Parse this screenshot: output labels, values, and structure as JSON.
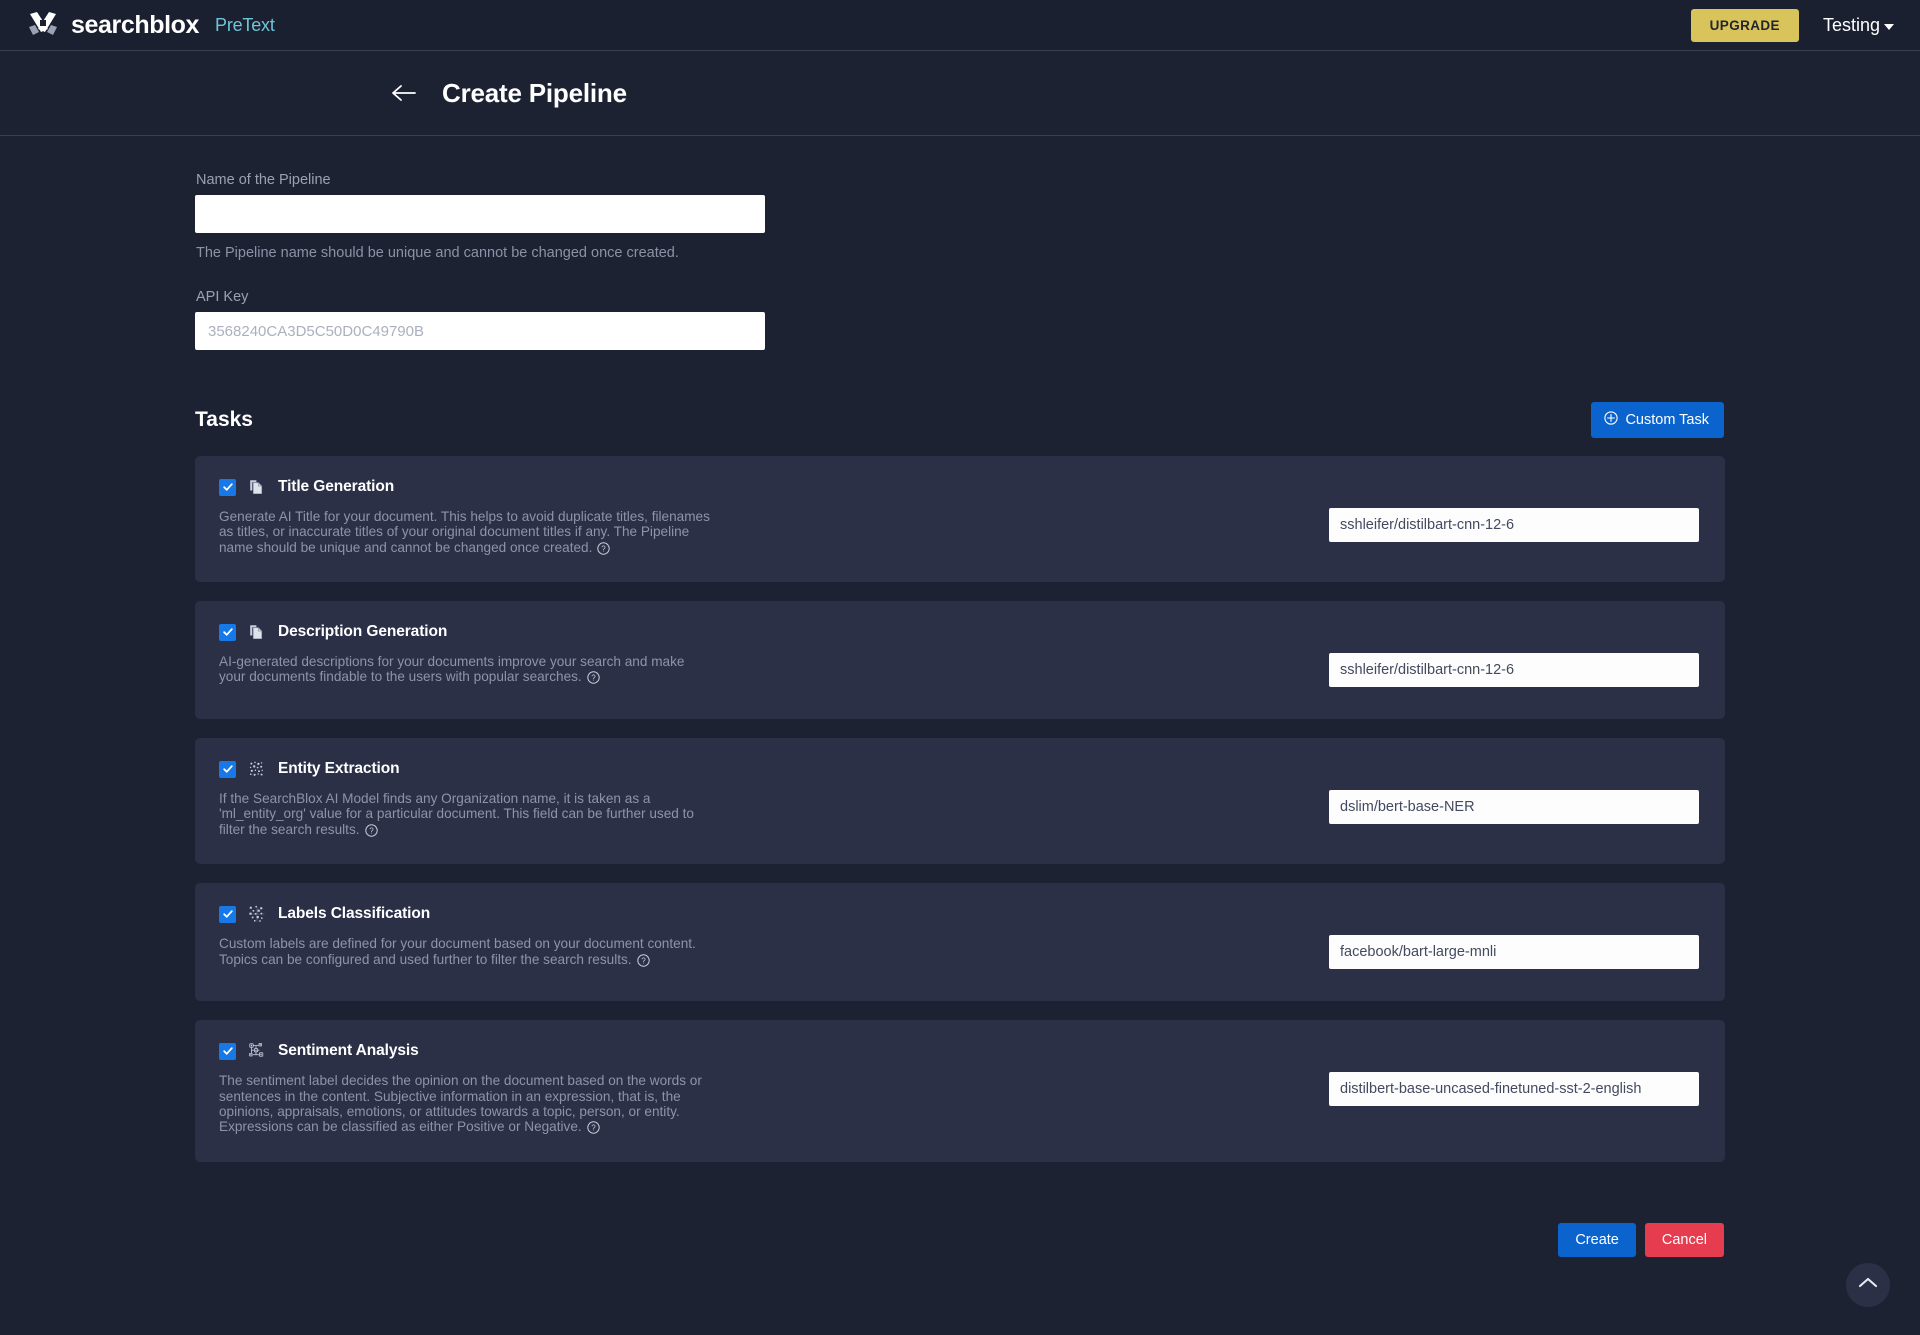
{
  "navbar": {
    "brand_name": "searchblox",
    "brand_sub": "PreText",
    "logo_icon": "searchblox-x-logo-icon",
    "upgrade_label": "UPGRADE",
    "user_label": "Testing",
    "caret_icon": "chevron-down-icon"
  },
  "titlebar": {
    "back_icon": "arrow-left-icon",
    "title": "Create Pipeline"
  },
  "form": {
    "name_label": "Name of the Pipeline",
    "name_value": "",
    "name_placeholder": "",
    "name_help": "The Pipeline name should be unique and cannot be changed once created.",
    "api_label": "API Key",
    "api_placeholder": "3568240CA3D5C50D0C49790B",
    "api_value": ""
  },
  "tasks_header": {
    "title": "Tasks",
    "custom_task_label": "Custom Task",
    "custom_task_icon": "plus-circle-icon"
  },
  "tasks": [
    {
      "id": "title-generation",
      "checked": true,
      "icon": "copy-document-icon",
      "title": "Title Generation",
      "description": "Generate AI Title for your document. This helps to avoid duplicate titles, filenames as titles, or inaccurate titles of your original document titles if any. The Pipeline name should be unique and cannot be changed once created.",
      "help_icon": "question-circle-icon",
      "model_value": "sshleifer/distilbart-cnn-12-6",
      "model_placeholder": "sshleifer/distilbart-cnn-12-6"
    },
    {
      "id": "description-generation",
      "checked": true,
      "icon": "copy-document-icon",
      "title": "Description Generation",
      "description": "AI-generated descriptions for your documents improve your search and make your documents findable to the users with popular searches.",
      "help_icon": "question-circle-icon",
      "model_value": "sshleifer/distilbart-cnn-12-6",
      "model_placeholder": "sshleifer/distilbart-cnn-12-6"
    },
    {
      "id": "entity-extraction",
      "checked": true,
      "icon": "scatter-dots-icon",
      "title": "Entity Extraction",
      "description": "If the SearchBlox AI Model finds any Organization name, it is taken as a 'ml_entity_org' value for a particular document. This field can be further used to filter the search results.",
      "help_icon": "question-circle-icon",
      "model_value": "dslim/bert-base-NER",
      "model_placeholder": "dslim/bert-base-NER"
    },
    {
      "id": "labels-classification",
      "checked": true,
      "icon": "label-cluster-icon",
      "title": "Labels Classification",
      "description": "Custom labels are defined for your document based on your document content. Topics can be configured and used further to filter the search results.",
      "help_icon": "question-circle-icon",
      "model_value": "facebook/bart-large-mnli",
      "model_placeholder": "facebook/bart-large-mnli"
    },
    {
      "id": "sentiment-analysis",
      "checked": true,
      "icon": "node-graph-icon",
      "title": "Sentiment Analysis",
      "description": "The sentiment label decides the opinion on the document based on the words or sentences in the content. Subjective information in an expression, that is, the opinions, appraisals, emotions, or attitudes towards a topic, person, or entity. Expressions can be classified as either Positive or Negative.",
      "help_icon": "question-circle-icon",
      "model_value": "distilbert-base-uncased-finetuned-sst-2-english",
      "model_placeholder": "distilbert-base-uncased-finetuned-sst-2-english"
    }
  ],
  "footer": {
    "create_label": "Create",
    "cancel_label": "Cancel"
  },
  "scroll_top": {
    "icon": "chevron-up-icon"
  },
  "colors": {
    "page_bg": "#1d2233",
    "navbar_bg": "#1b2031",
    "card_bg": "#2b3047",
    "accent_blue": "#0b63ce",
    "checkbox_blue": "#1779e8",
    "upgrade_yellow": "#d9c45c",
    "cancel_red": "#e63c4f",
    "brand_teal": "#6fc5d8",
    "muted_text": "#8d94a8"
  }
}
